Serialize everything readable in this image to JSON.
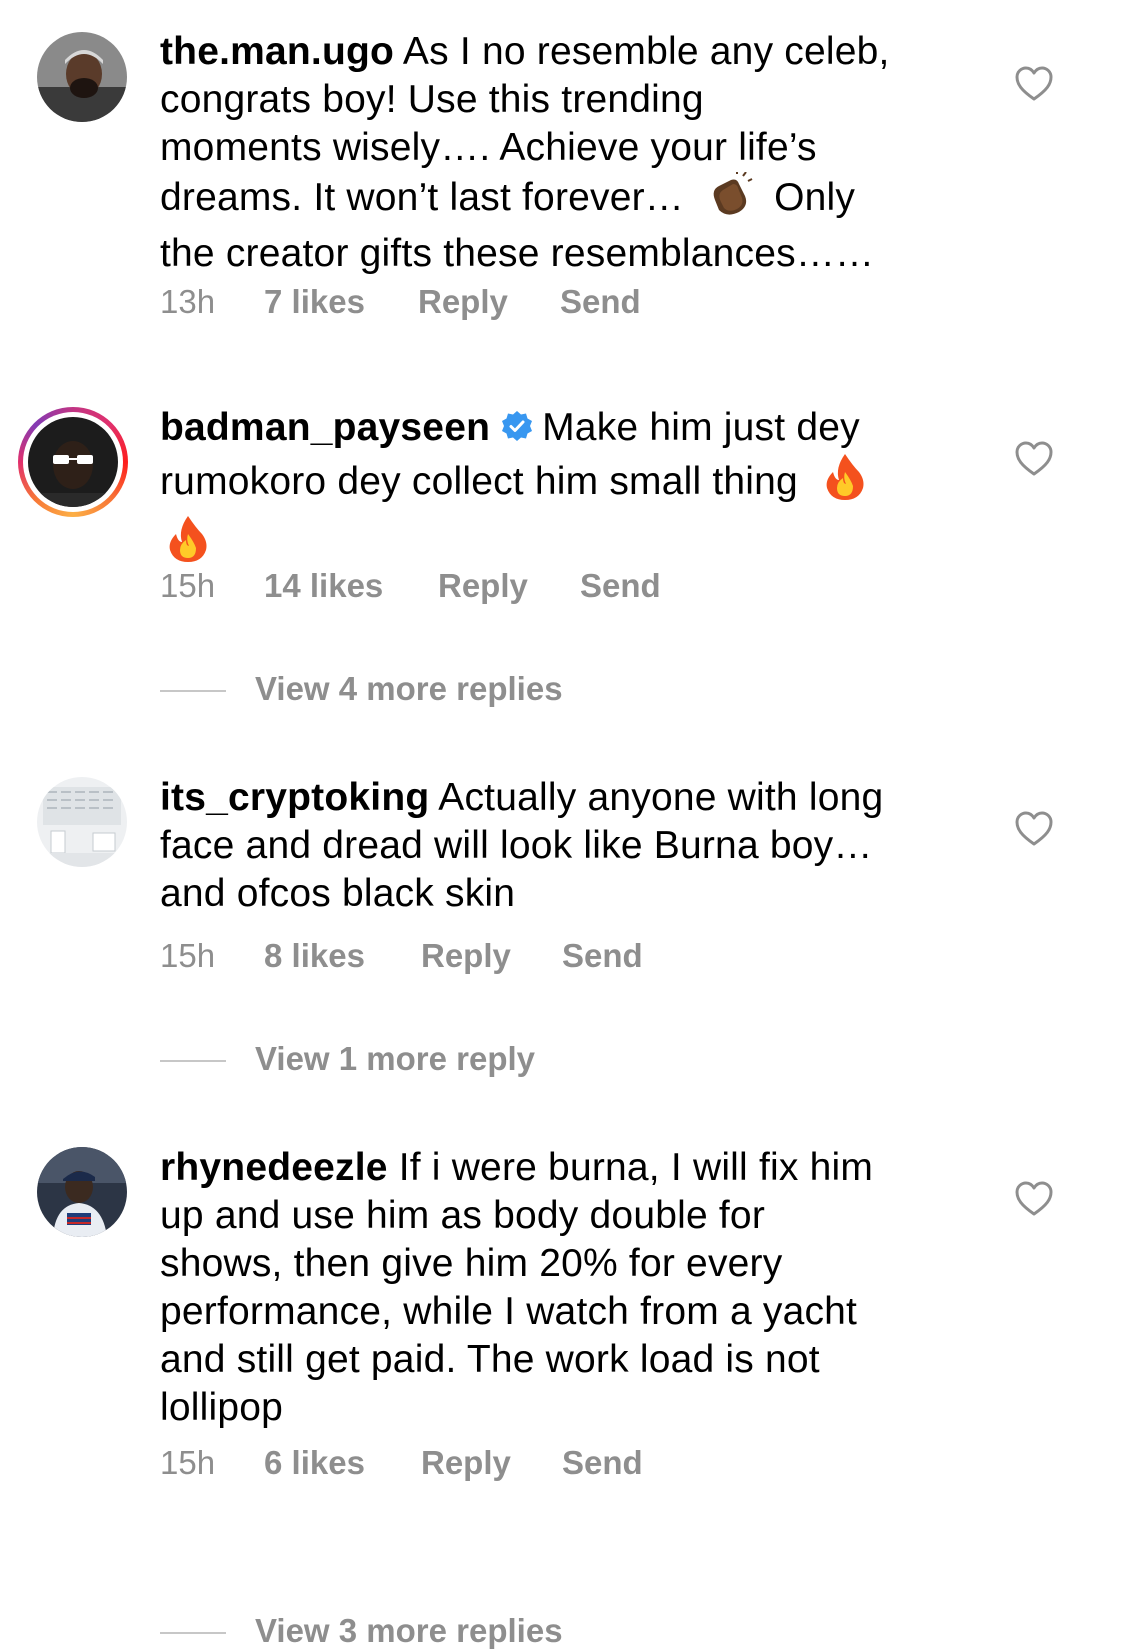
{
  "comments": [
    {
      "username": "the.man.ugo",
      "verified": false,
      "lines": [
        "As I no resemble any celeb,",
        "congrats boy! Use this trending",
        "moments wisely…. Achieve your life’s",
        "dreams. It won’t last forever…",
        "Only",
        "the creator gifts these resemblances……"
      ],
      "emoji": "clapping-hands-dark-skin",
      "time": "13h",
      "likes": "7 likes",
      "reply": "Reply",
      "send": "Send"
    },
    {
      "username": "badman_payseen",
      "verified": true,
      "lines": [
        "Make him just dey",
        "rumokoro dey collect him small thing"
      ],
      "emoji": "fire",
      "time": "15h",
      "likes": "14 likes",
      "reply": "Reply",
      "send": "Send",
      "view_more": "View 4 more replies"
    },
    {
      "username": "its_cryptoking",
      "verified": false,
      "lines": [
        "Actually anyone with long",
        "face and dread will look like Burna boy…",
        "and ofcos black skin"
      ],
      "time": "15h",
      "likes": "8 likes",
      "reply": "Reply",
      "send": "Send",
      "view_more": "View 1 more reply"
    },
    {
      "username": "rhynedeezle",
      "verified": false,
      "lines": [
        "If i were burna, I will fix him",
        "up and use him as body double for",
        "shows, then give him 20% for every",
        "performance, while I watch from a yacht",
        "and still get paid. The work load is not",
        "lollipop"
      ],
      "time": "15h",
      "likes": "6 likes",
      "reply": "Reply",
      "send": "Send",
      "view_more": "View 3 more replies"
    }
  ],
  "colors": {
    "text": "#000000",
    "secondary": "#8e8e8e",
    "verified_blue": "#3897f0",
    "divider": "#c7c7c7"
  },
  "icons": {
    "like": "heart-outline-icon",
    "verified": "verified-badge-icon"
  }
}
